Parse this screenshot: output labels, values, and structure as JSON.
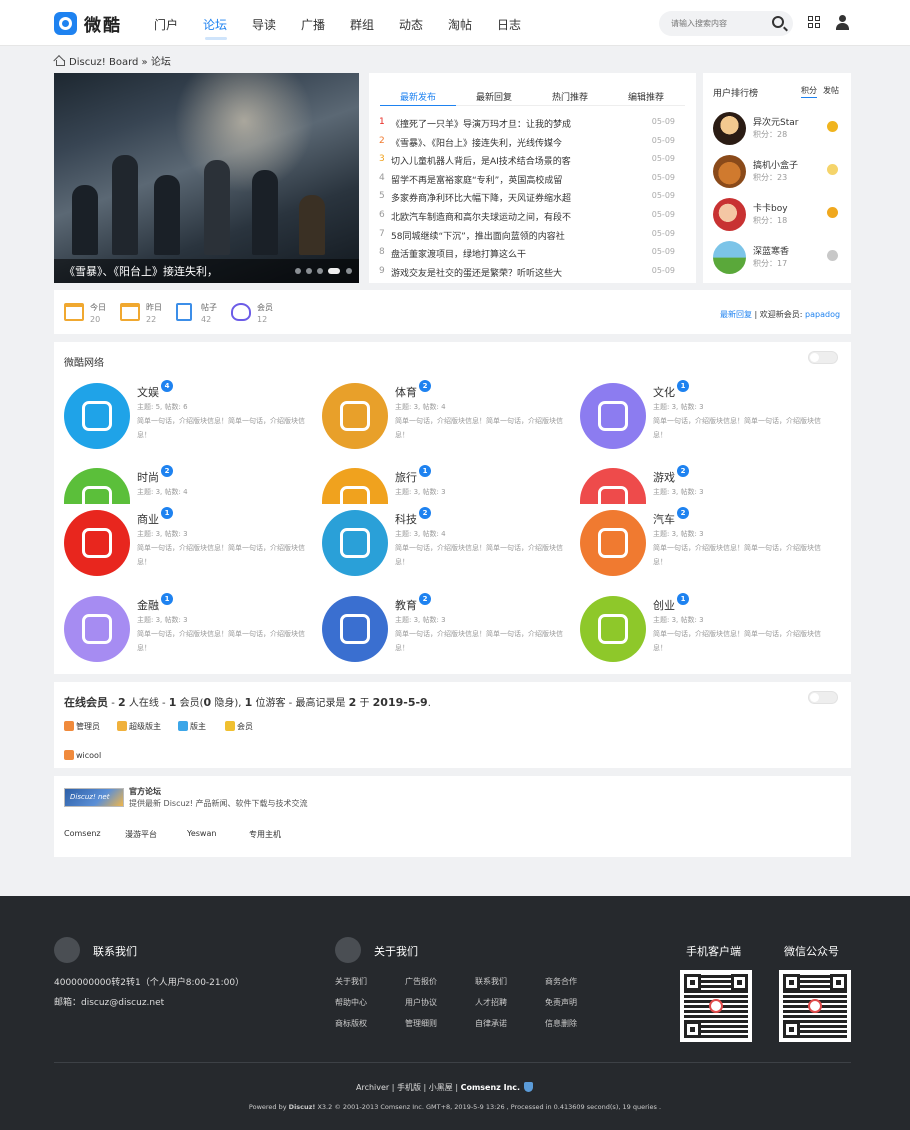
{
  "header": {
    "logo_text": "微酷",
    "nav": [
      "门户",
      "论坛",
      "导读",
      "广播",
      "群组",
      "动态",
      "淘帖",
      "日志"
    ],
    "active_nav": "论坛",
    "search_placeholder": "请输入搜索内容"
  },
  "breadcrumb": {
    "root": "Discuz! Board",
    "sep": "»",
    "current": "论坛"
  },
  "slider": {
    "caption": "《雪暴》、《阳台上》接连失利，",
    "dots": 5,
    "active_dot": 4
  },
  "news": {
    "tabs": [
      "最新发布",
      "最新回复",
      "热门推荐",
      "编辑推荐"
    ],
    "items": [
      {
        "num": "1",
        "title": "《撞死了一只羊》导演万玛才旦：让我的梦成",
        "date": "05-09"
      },
      {
        "num": "2",
        "title": "《雪暴》、《阳台上》接连失利，光线传媒今",
        "date": "05-09"
      },
      {
        "num": "3",
        "title": "切入儿童机器人背后，是AI技术结合场景的客",
        "date": "05-09"
      },
      {
        "num": "4",
        "title": "留学不再是富裕家庭“专利”，英国高校成留",
        "date": "05-09"
      },
      {
        "num": "5",
        "title": "多家券商净利环比大幅下降，天风证券缩水超",
        "date": "05-09"
      },
      {
        "num": "6",
        "title": "北欧汽车制造商和高尔夫球运动之间，有段不",
        "date": "05-09"
      },
      {
        "num": "7",
        "title": "58同城继续“下沉”，推出面向蓝领的内容社",
        "date": "05-09"
      },
      {
        "num": "8",
        "title": "盘活董家渡项目，绿地打算这么干",
        "date": "05-09"
      },
      {
        "num": "9",
        "title": "游戏交友是社交的蛋还是繁荣？听听这些大",
        "date": "05-09"
      }
    ]
  },
  "ranking": {
    "title": "用户排行榜",
    "tabs": [
      "积分",
      "发帖"
    ],
    "users": [
      {
        "name": "异次元Star",
        "points": "积分：28"
      },
      {
        "name": "搞机小盒子",
        "points": "积分：23"
      },
      {
        "name": "卡卡boy",
        "points": "积分：18"
      },
      {
        "name": "深蓝寒香",
        "points": "积分：17"
      }
    ]
  },
  "stats": {
    "items": [
      {
        "label": "今日",
        "value": "20"
      },
      {
        "label": "昨日",
        "value": "22"
      },
      {
        "label": "帖子",
        "value": "42"
      },
      {
        "label": "会员",
        "value": "12"
      }
    ],
    "latest_reply": "最新回复",
    "welcome": "欢迎新会员:",
    "new_member": "papadog"
  },
  "forums": {
    "section_title": "微酷网络",
    "desc": "简单一句话，介绍版块信息！简单一句话，介绍版块信息！",
    "items": [
      {
        "name": "文娱",
        "badge": "4",
        "meta": "主题: 5, 帖数: 6",
        "color": "#1fa3e8"
      },
      {
        "name": "体育",
        "badge": "2",
        "meta": "主题: 3, 帖数: 4",
        "color": "#e8a02a"
      },
      {
        "name": "文化",
        "badge": "1",
        "meta": "主题: 3, 帖数: 3",
        "color": "#8c7cf0"
      },
      {
        "name": "时尚",
        "badge": "2",
        "meta": "主题: 3, 帖数: 4",
        "color": "#5bbf3a"
      },
      {
        "name": "旅行",
        "badge": "1",
        "meta": "主题: 3, 帖数: 3",
        "color": "#f0a21e"
      },
      {
        "name": "游戏",
        "badge": "2",
        "meta": "主题: 3, 帖数: 3",
        "color": "#ee4b4b"
      },
      {
        "name": "商业",
        "badge": "1",
        "meta": "主题: 3, 帖数: 3",
        "color": "#e8261e"
      },
      {
        "name": "科技",
        "badge": "2",
        "meta": "主题: 3, 帖数: 4",
        "color": "#2aa0d8"
      },
      {
        "name": "汽车",
        "badge": "2",
        "meta": "主题: 3, 帖数: 3",
        "color": "#f07a30"
      },
      {
        "name": "金融",
        "badge": "1",
        "meta": "主题: 3, 帖数: 3",
        "color": "#a68cf2"
      },
      {
        "name": "教育",
        "badge": "2",
        "meta": "主题: 3, 帖数: 3",
        "color": "#3a6fd0"
      },
      {
        "name": "创业",
        "badge": "1",
        "meta": "主题: 3, 帖数: 3",
        "color": "#8ec82a"
      }
    ]
  },
  "online": {
    "title": "在线会员",
    "summary_pre": "- ",
    "total": "2",
    "s1": " 人在线 - ",
    "members": "1",
    "s2": " 会员(",
    "hidden": "0",
    "s3": " 隐身), ",
    "guests": "1",
    "s4": " 位游客 - 最高记录是 ",
    "record": "2",
    "s5": " 于 ",
    "record_date": "2019-5-9",
    "s6": ".",
    "legend": [
      {
        "label": "管理员",
        "color": "#f08a3c"
      },
      {
        "label": "超级版主",
        "color": "#f0b13c"
      },
      {
        "label": "版主",
        "color": "#3ca6e8"
      },
      {
        "label": "会员",
        "color": "#f0c030"
      }
    ],
    "user": "wicool"
  },
  "links": {
    "logo_text": "Discuz! net",
    "official_title": "官方论坛",
    "official_desc": "提供最新 Discuz! 产品新闻、软件下载与技术交流",
    "items": [
      "Comsenz",
      "漫游平台",
      "Yeswan",
      "专用主机"
    ]
  },
  "footer": {
    "contact_title": "联系我们",
    "phone": "4000000000转2转1（个人用户8:00-21:00）",
    "email": "邮箱：discuz@discuz.net",
    "about_title": "关于我们",
    "about_links": [
      "关于我们",
      "广告报价",
      "联系我们",
      "商务合作",
      "帮助中心",
      "用户协议",
      "人才招聘",
      "免责声明",
      "商标版权",
      "管理细则",
      "自律承诺",
      "信息删除"
    ],
    "mobile_title": "手机客户端",
    "wechat_title": "微信公众号",
    "nav_archiver": "Archiver",
    "nav_mobile": "手机版",
    "nav_dark": "小黑屋",
    "company": "Comsenz Inc.",
    "powered_pre": "Powered by ",
    "powered_brand": "Discuz!",
    "powered_rest": " X3.2 © 2001-2013 Comsenz Inc. GMT+8, 2019-5-9 13:26 , Processed in 0.413609 second(s), 19 queries ."
  }
}
